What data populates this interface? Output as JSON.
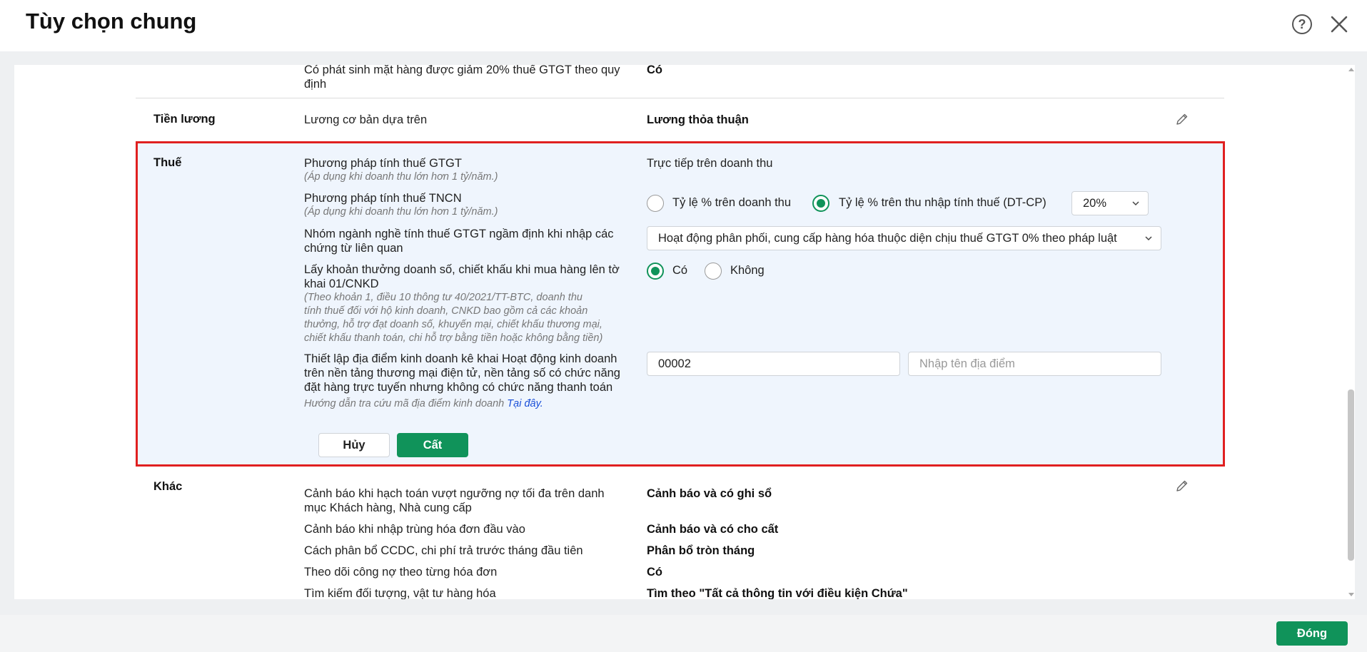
{
  "header": {
    "title": "Tùy chọn chung",
    "help_glyph": "?"
  },
  "top_row": {
    "label_line1": "Có phát sinh mặt hàng được giảm 20% thuế GTGT theo quy",
    "label_line2": "định",
    "value": "Có"
  },
  "salary": {
    "section": "Tiền lương",
    "label": "Lương cơ bản dựa trên",
    "value": "Lương thỏa thuận"
  },
  "tax": {
    "section": "Thuế",
    "vat_method": {
      "label": "Phương pháp tính thuế GTGT",
      "note": "(Áp dụng khi doanh thu lớn hơn 1 tỷ/năm.)",
      "value": "Trực tiếp trên doanh thu"
    },
    "pit_method": {
      "label": "Phương pháp tính thuế TNCN",
      "note": "(Áp dụng khi doanh thu lớn hơn 1 tỷ/năm.)",
      "options": [
        "Tỷ lệ % trên doanh thu",
        "Tỷ lệ % trên thu nhập tính thuế (DT-CP)"
      ],
      "selected_index": 1,
      "rate": "20%"
    },
    "industry_group": {
      "label_line1": "Nhóm ngành nghề tính thuế GTGT ngầm định khi nhập các",
      "label_line2": "chứng từ liên quan",
      "value": "Hoạt động phân phối, cung cấp hàng hóa thuộc diện chịu thuế GTGT 0% theo pháp luật"
    },
    "bonus_discount": {
      "label_line1": "Lấy khoản thưởng doanh số, chiết khấu khi mua hàng lên tờ",
      "label_line2": "khai 01/CNKD",
      "note_lines": [
        "(Theo khoản 1, điều 10 thông tư 40/2021/TT-BTC, doanh thu",
        "tính thuế đối với hộ kinh doanh, CNKD bao gồm cả các khoản",
        "thưởng, hỗ trợ đạt doanh số, khuyến mại, chiết khấu thương mại,",
        "chiết khấu thanh toán, chi hỗ trợ bằng tiền hoặc không bằng tiền)"
      ],
      "options": [
        "Có",
        "Không"
      ],
      "selected_index": 0
    },
    "business_location": {
      "label_lines": [
        "Thiết lập địa điểm kinh doanh kê khai Hoạt động kinh doanh",
        "trên nền tảng thương mại điện tử, nền tảng số có chức năng",
        "đặt hàng trực tuyến nhưng không có chức năng thanh toán"
      ],
      "guide_text": "Hướng dẫn tra cứu mã địa điểm kinh doanh ",
      "guide_link": "Tại đây.",
      "code_value": "00002",
      "name_placeholder": "Nhập tên địa điểm"
    },
    "cancel_label": "Hủy",
    "save_label": "Cất"
  },
  "other": {
    "section": "Khác",
    "rows": [
      {
        "label_line1": "Cảnh báo khi hạch toán vượt ngưỡng nợ tối đa trên danh",
        "label_line2": "mục Khách hàng, Nhà cung cấp",
        "value": "Cảnh báo và có ghi sổ"
      },
      {
        "label_line1": "Cảnh báo khi nhập trùng hóa đơn đầu vào",
        "value": "Cảnh báo và có cho cất"
      },
      {
        "label_line1": "Cách phân bổ CCDC, chi phí trả trước tháng đầu tiên",
        "value": "Phân bổ tròn tháng"
      },
      {
        "label_line1": "Theo dõi công nợ theo từng hóa đơn",
        "value": "Có"
      },
      {
        "label_line1": "Tìm kiếm đối tượng, vật tư hàng hóa",
        "value": "Tìm theo \"Tất cả thông tin với điều kiện Chứa\""
      }
    ]
  },
  "footer": {
    "close_label": "Đóng"
  },
  "colors": {
    "accent": "#10935a",
    "highlight_border": "#e02020",
    "highlight_bg": "#eff5fd",
    "link": "#1a4fd8"
  }
}
